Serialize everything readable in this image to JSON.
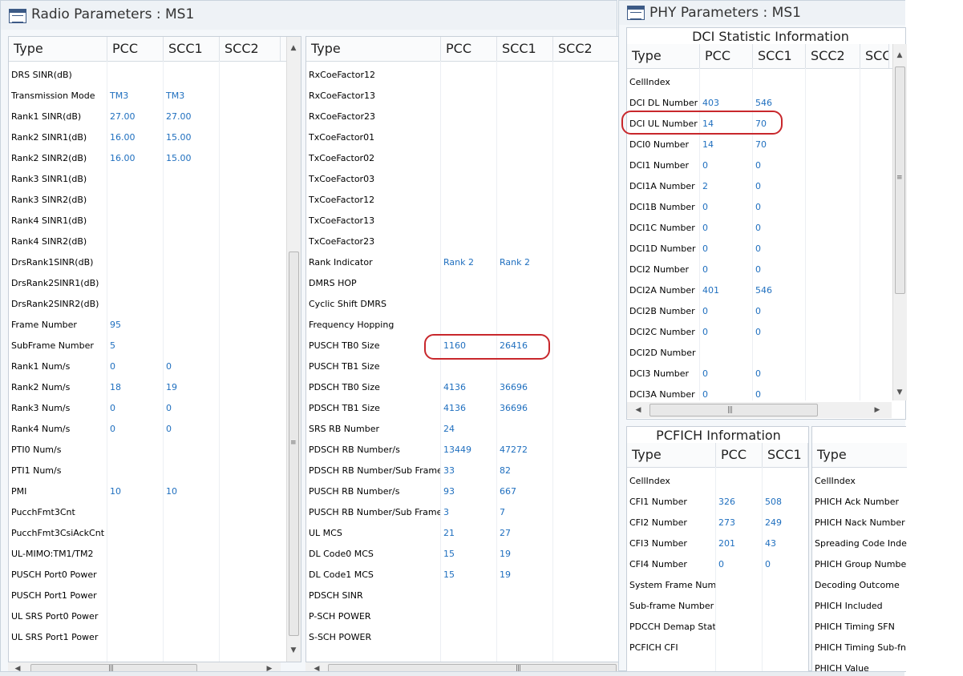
{
  "radio_window": {
    "title": "Radio Parameters : MS1",
    "left_table": {
      "headers": [
        "Type",
        "PCC",
        "SCC1",
        "SCC2"
      ],
      "rows": [
        [
          "DRS SINR(dB)",
          "",
          ""
        ],
        [
          "Transmission Mode",
          "TM3",
          "TM3"
        ],
        [
          "Rank1 SINR(dB)",
          "27.00",
          "27.00"
        ],
        [
          "Rank2 SINR1(dB)",
          "16.00",
          "15.00"
        ],
        [
          "Rank2 SINR2(dB)",
          "16.00",
          "15.00"
        ],
        [
          "Rank3 SINR1(dB)",
          "",
          ""
        ],
        [
          "Rank3 SINR2(dB)",
          "",
          ""
        ],
        [
          "Rank4 SINR1(dB)",
          "",
          ""
        ],
        [
          "Rank4 SINR2(dB)",
          "",
          ""
        ],
        [
          "DrsRank1SINR(dB)",
          "",
          ""
        ],
        [
          "DrsRank2SINR1(dB)",
          "",
          ""
        ],
        [
          "DrsRank2SINR2(dB)",
          "",
          ""
        ],
        [
          "Frame Number",
          "95",
          ""
        ],
        [
          "SubFrame Number",
          "5",
          ""
        ],
        [
          "Rank1 Num/s",
          "0",
          "0"
        ],
        [
          "Rank2 Num/s",
          "18",
          "19"
        ],
        [
          "Rank3 Num/s",
          "0",
          "0"
        ],
        [
          "Rank4 Num/s",
          "0",
          "0"
        ],
        [
          "PTI0 Num/s",
          "",
          ""
        ],
        [
          "PTI1 Num/s",
          "",
          ""
        ],
        [
          "PMI",
          "10",
          "10"
        ],
        [
          "PucchFmt3Cnt",
          "",
          ""
        ],
        [
          "PucchFmt3CsiAckCnt",
          "",
          ""
        ],
        [
          "UL-MIMO:TM1/TM2",
          "",
          ""
        ],
        [
          "PUSCH Port0 Power",
          "",
          ""
        ],
        [
          "PUSCH Port1 Power",
          "",
          ""
        ],
        [
          "UL SRS Port0 Power",
          "",
          ""
        ],
        [
          "UL SRS Port1 Power",
          "",
          ""
        ]
      ]
    },
    "right_table": {
      "headers": [
        "Type",
        "PCC",
        "SCC1",
        "SCC2"
      ],
      "rows": [
        [
          "RxCoeFactor12",
          "",
          ""
        ],
        [
          "RxCoeFactor13",
          "",
          ""
        ],
        [
          "RxCoeFactor23",
          "",
          ""
        ],
        [
          "TxCoeFactor01",
          "",
          ""
        ],
        [
          "TxCoeFactor02",
          "",
          ""
        ],
        [
          "TxCoeFactor03",
          "",
          ""
        ],
        [
          "TxCoeFactor12",
          "",
          ""
        ],
        [
          "TxCoeFactor13",
          "",
          ""
        ],
        [
          "TxCoeFactor23",
          "",
          ""
        ],
        [
          "Rank Indicator",
          "Rank 2",
          "Rank 2"
        ],
        [
          "DMRS HOP",
          "",
          ""
        ],
        [
          "Cyclic Shift DMRS",
          "",
          ""
        ],
        [
          "Frequency Hopping",
          "",
          ""
        ],
        [
          "PUSCH TB0 Size",
          "1160",
          "26416"
        ],
        [
          "PUSCH TB1 Size",
          "",
          ""
        ],
        [
          "PDSCH TB0 Size",
          "4136",
          "36696"
        ],
        [
          "PDSCH TB1 Size",
          "4136",
          "36696"
        ],
        [
          "SRS RB Number",
          "24",
          ""
        ],
        [
          "PDSCH RB Number/s",
          "13449",
          "47272"
        ],
        [
          "PDSCH RB Number/Sub Frame",
          "33",
          "82"
        ],
        [
          "PUSCH RB Number/s",
          "93",
          "667"
        ],
        [
          "PUSCH RB Number/Sub Frame",
          "3",
          "7"
        ],
        [
          "UL MCS",
          "21",
          "27"
        ],
        [
          "DL Code0 MCS",
          "15",
          "19"
        ],
        [
          "DL Code1 MCS",
          "15",
          "19"
        ],
        [
          "PDSCH SINR",
          "",
          ""
        ],
        [
          "P-SCH POWER",
          "",
          ""
        ],
        [
          "S-SCH POWER",
          "",
          ""
        ]
      ]
    }
  },
  "phy_window": {
    "title": "PHY Parameters : MS1",
    "dci": {
      "title": "DCI Statistic Information",
      "headers": [
        "Type",
        "PCC",
        "SCC1",
        "SCC2",
        "SCC."
      ],
      "rows": [
        [
          "CellIndex",
          "",
          ""
        ],
        [
          "DCI DL Number",
          "403",
          "546"
        ],
        [
          "DCI UL Number",
          "14",
          "70"
        ],
        [
          "DCI0 Number",
          "14",
          "70"
        ],
        [
          "DCI1 Number",
          "0",
          "0"
        ],
        [
          "DCI1A Number",
          "2",
          "0"
        ],
        [
          "DCI1B Number",
          "0",
          "0"
        ],
        [
          "DCI1C Number",
          "0",
          "0"
        ],
        [
          "DCI1D Number",
          "0",
          "0"
        ],
        [
          "DCI2 Number",
          "0",
          "0"
        ],
        [
          "DCI2A Number",
          "401",
          "546"
        ],
        [
          "DCI2B Number",
          "0",
          "0"
        ],
        [
          "DCI2C Number",
          "0",
          "0"
        ],
        [
          "DCI2D Number",
          "",
          ""
        ],
        [
          "DCI3 Number",
          "0",
          "0"
        ],
        [
          "DCI3A Number",
          "0",
          "0"
        ]
      ]
    },
    "pcfich": {
      "title": "PCFICH Information",
      "headers": [
        "Type",
        "PCC",
        "SCC1"
      ],
      "rows": [
        [
          "CellIndex",
          "",
          ""
        ],
        [
          "CFI1 Number",
          "326",
          "508"
        ],
        [
          "CFI2 Number",
          "273",
          "249"
        ],
        [
          "CFI3 Number",
          "201",
          "43"
        ],
        [
          "CFI4 Number",
          "0",
          "0"
        ],
        [
          "System Frame Number",
          "",
          ""
        ],
        [
          "Sub-frame Number",
          "",
          ""
        ],
        [
          "PDCCH Demap Status",
          "",
          ""
        ],
        [
          "PCFICH CFI",
          "",
          ""
        ]
      ]
    },
    "phich": {
      "headers": [
        "Type"
      ],
      "rows": [
        [
          "CellIndex"
        ],
        [
          "PHICH Ack Number"
        ],
        [
          "PHICH Nack Number"
        ],
        [
          "Spreading Code Index"
        ],
        [
          "PHICH Group Number"
        ],
        [
          "Decoding Outcome"
        ],
        [
          "PHICH Included"
        ],
        [
          "PHICH Timing SFN"
        ],
        [
          "PHICH Timing Sub-fn"
        ],
        [
          "PHICH Value"
        ]
      ]
    }
  },
  "colors": {
    "value_text": "#1f6fbf",
    "highlight": "#c8272c",
    "window_bg": "#f4f7fa"
  },
  "icons": [
    "table-window-icon",
    "scroll-up-arrow-icon",
    "scroll-down-arrow-icon",
    "scroll-left-arrow-icon",
    "scroll-right-arrow-icon",
    "scroll-grip-icon"
  ]
}
